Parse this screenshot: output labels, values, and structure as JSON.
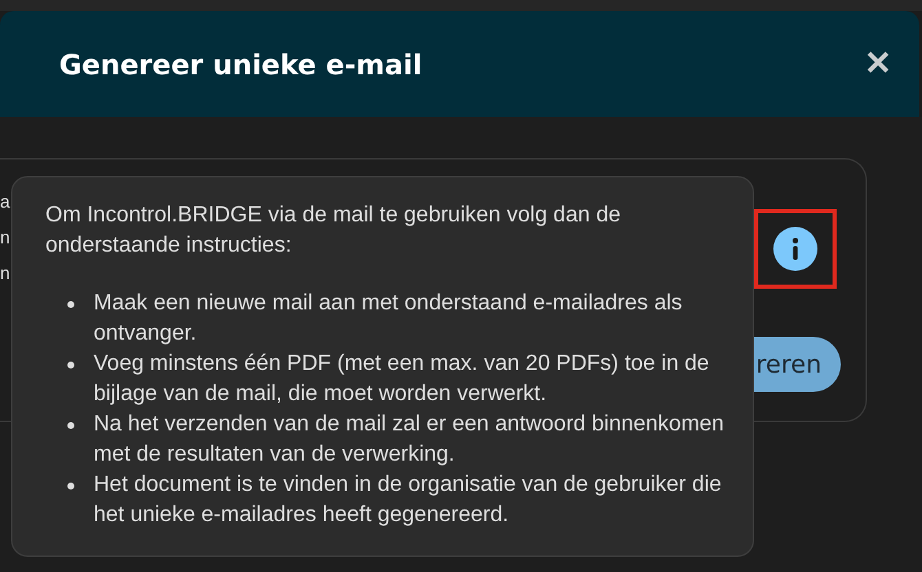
{
  "dialog": {
    "title": "Genereer unieke e-mail",
    "close": "✕"
  },
  "card": {
    "left_fragments": [
      "a",
      "n",
      "n"
    ],
    "button": "reren"
  },
  "tooltip": {
    "intro": "Om Incontrol.BRIDGE via de mail te gebruiken volg dan de onderstaande instructies:",
    "items": [
      "Maak een nieuwe mail aan met onderstaand e-mailadres als ontvanger.",
      "Voeg minstens één PDF (met een max. van 20 PDFs) toe in de bijlage van de mail, die moet worden verwerkt.",
      "Na het verzenden van de mail zal er een antwoord binnenkomen met de resultaten van de verwerking.",
      "Het document is te vinden in de organisatie van de gebruiker die het unieke e-mailadres heeft gegenereerd."
    ]
  },
  "info_highlighted": true
}
